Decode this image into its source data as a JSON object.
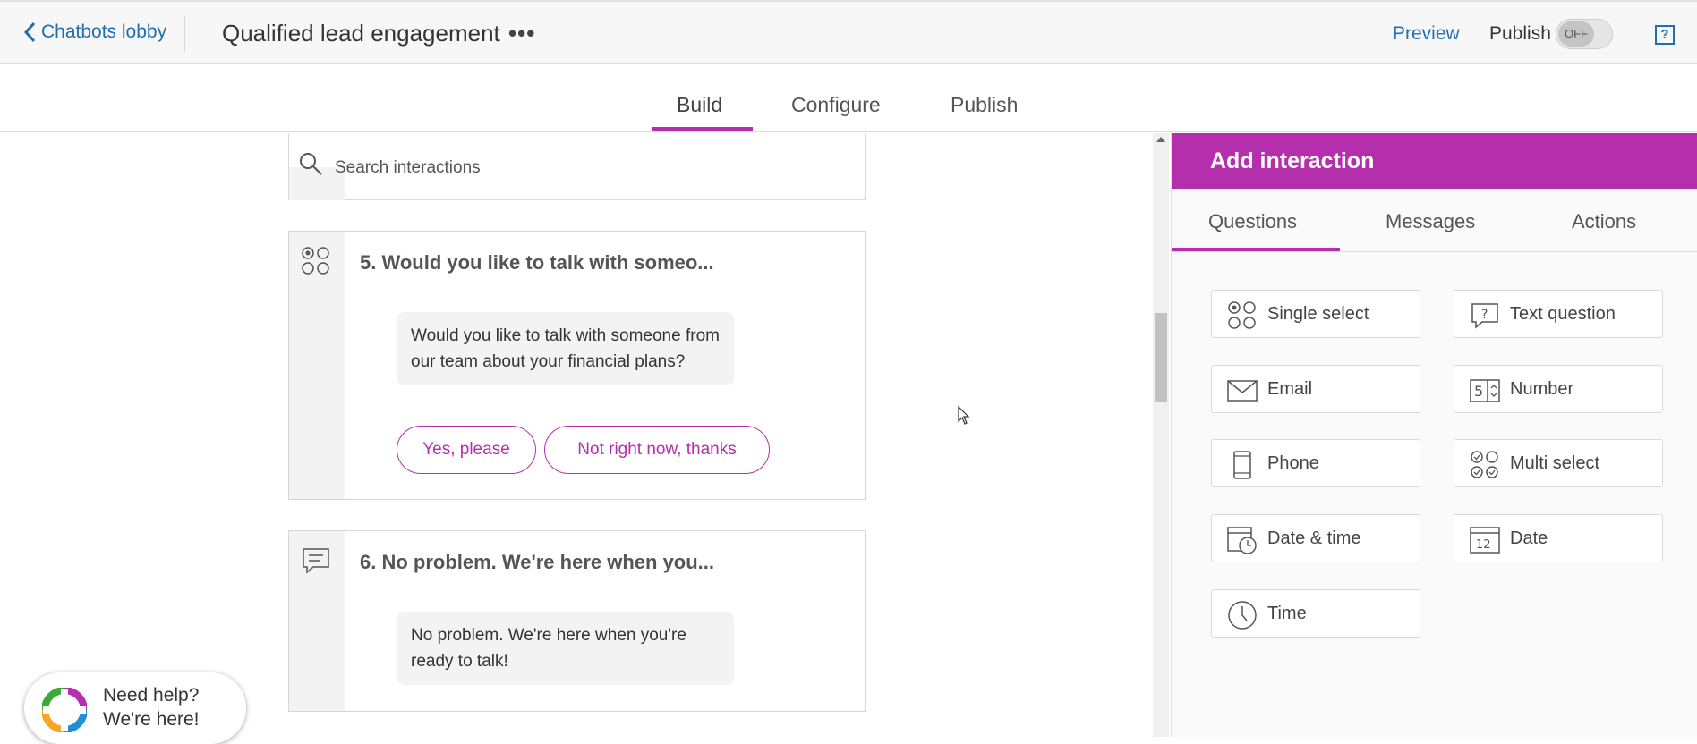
{
  "header": {
    "back_label": "Chatbots lobby",
    "title": "Qualified lead engagement",
    "more_label": "•••",
    "preview_label": "Preview",
    "publish_label": "Publish",
    "toggle_state": "OFF",
    "help_label": "?"
  },
  "tabs": [
    {
      "label": "Build",
      "active": true
    },
    {
      "label": "Configure",
      "active": false
    },
    {
      "label": "Publish",
      "active": false
    }
  ],
  "search": {
    "placeholder": "Search interactions"
  },
  "cards": [
    {
      "title": "5. Would you like to talk with someo...",
      "icon": "single-select-icon",
      "message": "Would you like to talk with someone from our team about your financial plans?",
      "options": [
        "Yes, please",
        "Not right now, thanks"
      ]
    },
    {
      "title": "6. No problem. We're here when you...",
      "icon": "message-icon",
      "message": "No problem. We're here when you're ready to talk!"
    }
  ],
  "panel": {
    "title": "Add interaction",
    "tabs": [
      {
        "label": "Questions",
        "active": true
      },
      {
        "label": "Messages",
        "active": false
      },
      {
        "label": "Actions",
        "active": false
      }
    ],
    "questions": [
      {
        "label": "Single select",
        "icon": "single-select-icon"
      },
      {
        "label": "Text question",
        "icon": "text-question-icon"
      },
      {
        "label": "Email",
        "icon": "email-icon"
      },
      {
        "label": "Number",
        "icon": "number-icon"
      },
      {
        "label": "Phone",
        "icon": "phone-icon"
      },
      {
        "label": "Multi select",
        "icon": "multi-select-icon"
      },
      {
        "label": "Date & time",
        "icon": "date-time-icon"
      },
      {
        "label": "Date",
        "icon": "calendar-icon"
      },
      {
        "label": "Time",
        "icon": "clock-icon"
      }
    ]
  },
  "help_widget": {
    "line1": "Need help?",
    "line2": "We're here!"
  },
  "colors": {
    "accent": "#b52fad",
    "link": "#1f6fb2"
  }
}
